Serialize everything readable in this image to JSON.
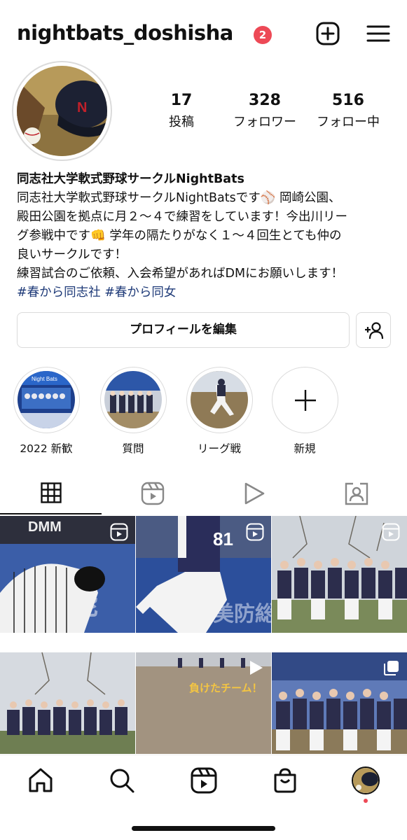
{
  "header": {
    "username": "nightbats_doshisha",
    "notification_count": "2"
  },
  "stats": [
    {
      "value": "17",
      "label": "投稿"
    },
    {
      "value": "328",
      "label": "フォロワー"
    },
    {
      "value": "516",
      "label": "フォロー中"
    }
  ],
  "bio": {
    "name": "同志社大学軟式野球サークルNightBats",
    "line1": "同志社大学軟式野球サークルNightBatsです⚾ 岡崎公園、",
    "line2": "殿田公園を拠点に月２〜４で練習をしています！今出川リー",
    "line3": "グ参戦中です👊 学年の隔たりがなく１〜４回生とても仲の",
    "line4": "良いサークルです！",
    "line5": "練習試合のご依頼、入会希望があればDMにお願いします！",
    "hashtags": "#春から同志社 #春から同女"
  },
  "buttons": {
    "edit_profile": "プロフィールを編集"
  },
  "highlights": [
    {
      "label": "2022 新歓",
      "thumb_text": "Night Bats"
    },
    {
      "label": "質問"
    },
    {
      "label": "リーグ戦"
    },
    {
      "label": "新規"
    }
  ],
  "grid": {
    "cell1_text": "DMM",
    "cell2_number": "81",
    "cell5_caption": "負けたチーム！"
  },
  "colors": {
    "badge": "#ed4956",
    "hashtag": "#1e3a78",
    "border": "#dbdbdb"
  }
}
